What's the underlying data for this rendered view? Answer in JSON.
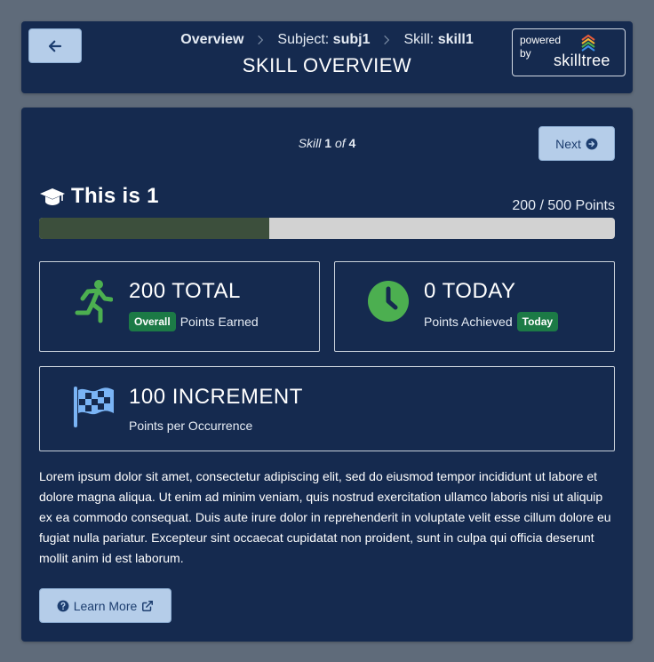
{
  "header": {
    "breadcrumb": {
      "overview": "Overview",
      "subject_prefix": "Subject: ",
      "subject_value": "subj1",
      "skill_prefix": "Skill: ",
      "skill_value": "skill1"
    },
    "title": "SKILL OVERVIEW",
    "powered_by": {
      "text": "powered by",
      "logo_text": "skilltree"
    }
  },
  "navigation": {
    "skill_word": "Skill",
    "current": "1",
    "of_word": "of",
    "total": "4",
    "next_label": "Next"
  },
  "skill": {
    "name": "This is 1",
    "points_summary": "200 / 500 Points",
    "progress_fraction": 0.4
  },
  "stats": {
    "total": {
      "value": "200 TOTAL",
      "badge": "Overall",
      "label": "Points Earned"
    },
    "today": {
      "value": "0 TODAY",
      "label": "Points Achieved",
      "badge": "Today"
    },
    "increment": {
      "value": "100 INCREMENT",
      "label": "Points per Occurrence"
    }
  },
  "description": "Lorem ipsum dolor sit amet, consectetur adipiscing elit, sed do eiusmod tempor incididunt ut labore et dolore magna aliqua. Ut enim ad minim veniam, quis nostrud exercitation ullamco laboris nisi ut aliquip ex ea commodo consequat. Duis aute irure dolor in reprehenderit in voluptate velit esse cillum dolore eu fugiat nulla pariatur. Excepteur sint occaecat cupidatat non proident, sunt in culpa qui officia deserunt mollit anim id est laborum.",
  "learn_more_label": "Learn More",
  "icons": {
    "back": "arrow-left-icon",
    "next": "arrow-circle-right-icon",
    "skill": "graduation-cap-icon",
    "total": "running-person-icon",
    "today": "clock-icon",
    "increment": "checkered-flag-icon",
    "learn_more": "question-circle-icon",
    "external": "external-link-icon"
  },
  "colors": {
    "background": "#5f6b7a",
    "card": "#152a4f",
    "button": "#b5cde9",
    "progress_fill": "#3c4f3c",
    "progress_track": "#d2d2d2",
    "badge": "#1c7a46",
    "icon_green": "#4caf50",
    "icon_blue": "#7ab4f5"
  }
}
